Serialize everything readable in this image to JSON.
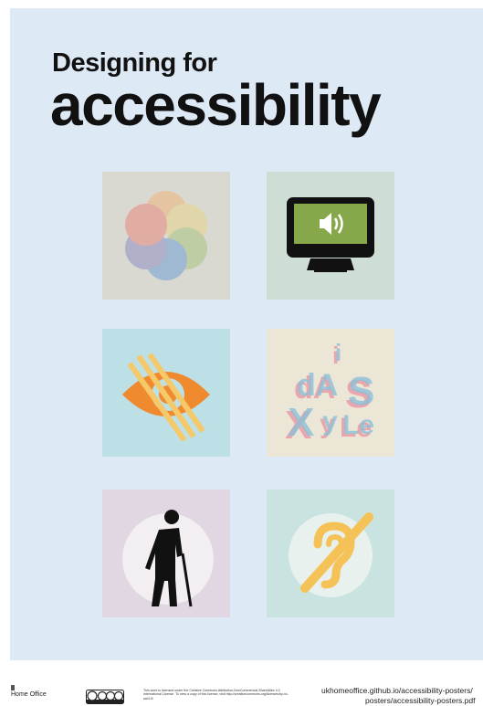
{
  "poster": {
    "title_line1": "Designing for",
    "title_line2": "accessibility",
    "background": "#dde9f5",
    "tiles": [
      {
        "icon": "colour-circles-icon",
        "bg": "#d9d9d1"
      },
      {
        "icon": "monitor-speaker-icon",
        "bg": "#cfded5"
      },
      {
        "icon": "crossed-eye-icon",
        "bg": "#bde0e6"
      },
      {
        "icon": "dyslexia-letters-icon",
        "bg": "#ece6d7"
      },
      {
        "icon": "person-with-cane-icon",
        "bg": "#e0d7e2"
      },
      {
        "icon": "hearing-impaired-icon",
        "bg": "#c8e3e0"
      }
    ]
  },
  "footer": {
    "org": "Home Office",
    "cc_badge": "cc by nc sa",
    "license_text": "This work is licensed under the Creative Commons Attribution-NonCommercial-ShareAlike 4.0 International License. To view a copy of this license, visit http://creativecommons.org/licenses/by-nc-sa/4.0/",
    "url_line1": "ukhomeoffice.github.io/accessibility-posters/",
    "url_line2": "posters/accessibility-posters.pdf"
  }
}
